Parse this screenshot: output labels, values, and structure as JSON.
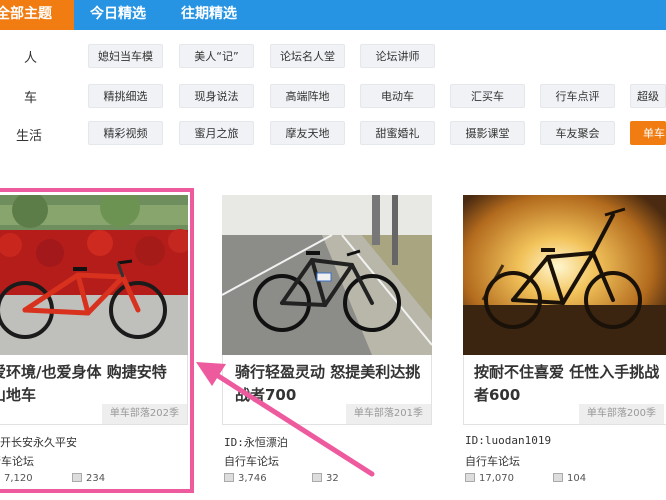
{
  "nav": {
    "tabs": [
      {
        "label": "全部主题",
        "active": true
      },
      {
        "label": "今日精选",
        "active": false
      },
      {
        "label": "往期精选",
        "active": false
      }
    ]
  },
  "categories": [
    {
      "label": "人",
      "items": [
        "媳妇当车模",
        "美人“记”",
        "论坛名人堂",
        "论坛讲师"
      ]
    },
    {
      "label": "车",
      "items": [
        "精挑细选",
        "现身说法",
        "高端阵地",
        "电动车",
        "汇买车",
        "行车点评",
        "超级"
      ]
    },
    {
      "label": "生活",
      "items": [
        "精彩视频",
        "蜜月之旅",
        "摩友天地",
        "甜蜜婚礼",
        "摄影课堂",
        "车友聚会",
        "单车"
      ]
    }
  ],
  "cards": [
    {
      "title_line1": "爱环境/也爱身体 购捷安特",
      "title_line2": "山地车",
      "season": "单车部落202季",
      "author": "开长安永久平安",
      "forum": "行车论坛",
      "views": "7,120",
      "comments": "234"
    },
    {
      "title_line1": "骑行轻盈灵动 怒提美利达挑",
      "title_line2": "战者700",
      "season": "单车部落201季",
      "author": "ID:永恒漂泊",
      "forum": "自行车论坛",
      "views": "3,746",
      "comments": "32"
    },
    {
      "title_line1": "按耐不住喜爱 任性入手挑战",
      "title_line2": "者600",
      "season": "单车部落200季",
      "author": "ID:luodan1019",
      "forum": "自行车论坛",
      "views": "17,070",
      "comments": "104"
    }
  ],
  "colors": {
    "nav_blue": "#2694e3",
    "accent_orange": "#f07c12",
    "highlight_pink": "#ee5a9e"
  },
  "icons": {
    "views": "image-icon",
    "comments": "comment-icon"
  }
}
